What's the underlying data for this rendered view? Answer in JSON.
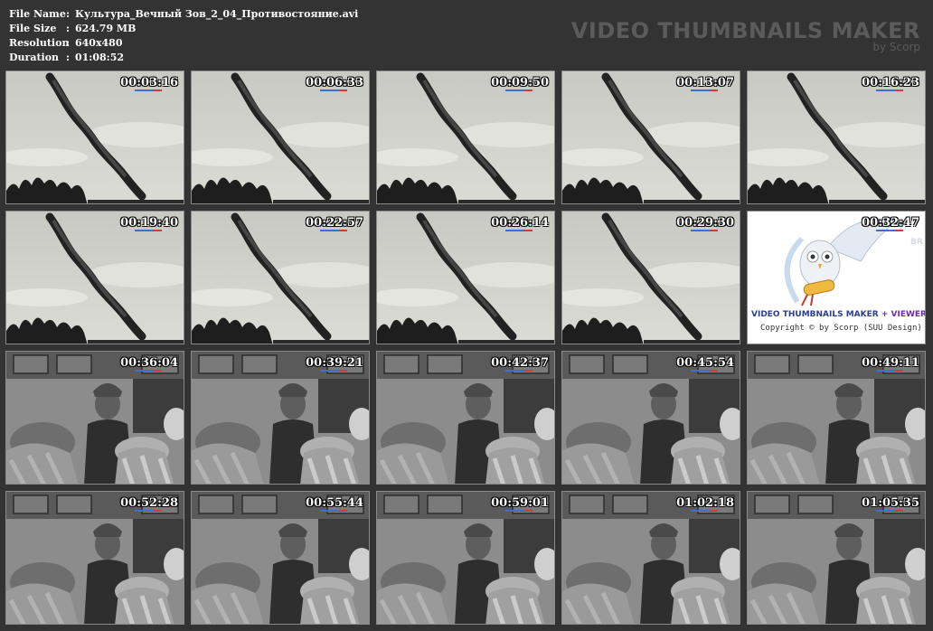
{
  "info": {
    "rows": [
      {
        "label": "File Name",
        "sep": ":",
        "value": "Культура_Вечный Зов_2_04_Противостояние.avi"
      },
      {
        "label": "File Size",
        "sep": ":",
        "value": "624.79 MB"
      },
      {
        "label": "Resolution",
        "sep": ":",
        "value": "640x480"
      },
      {
        "label": "Duration",
        "sep": ":",
        "value": "01:08:52"
      }
    ]
  },
  "brand": {
    "title": "VIDEO THUMBNAILS MAKER",
    "by": "by Scorp"
  },
  "logo_tile": {
    "title_a": "VIDEO THUMBNAILS MAKER",
    "title_sep": "+",
    "title_b": "VIEWER",
    "copyright": "Copyright © by Scorp (SUU Design)"
  },
  "thumbnails": [
    {
      "time": "00:03:16",
      "scene": "smoke"
    },
    {
      "time": "00:06:33",
      "scene": "smoke"
    },
    {
      "time": "00:09:50",
      "scene": "smoke"
    },
    {
      "time": "00:13:07",
      "scene": "smoke"
    },
    {
      "time": "00:16:23",
      "scene": "smoke"
    },
    {
      "time": "00:19:40",
      "scene": "smoke"
    },
    {
      "time": "00:22:57",
      "scene": "smoke"
    },
    {
      "time": "00:26:14",
      "scene": "smoke"
    },
    {
      "time": "00:29:30",
      "scene": "smoke"
    },
    {
      "time": "00:32:47",
      "scene": "logo"
    },
    {
      "time": "00:36:04",
      "scene": "crowd"
    },
    {
      "time": "00:39:21",
      "scene": "crowd"
    },
    {
      "time": "00:42:37",
      "scene": "crowd"
    },
    {
      "time": "00:45:54",
      "scene": "crowd"
    },
    {
      "time": "00:49:11",
      "scene": "crowd"
    },
    {
      "time": "00:52:28",
      "scene": "crowd"
    },
    {
      "time": "00:55:44",
      "scene": "crowd"
    },
    {
      "time": "00:59:01",
      "scene": "crowd"
    },
    {
      "time": "01:02:18",
      "scene": "crowd"
    },
    {
      "time": "01:05:35",
      "scene": "crowd"
    }
  ]
}
